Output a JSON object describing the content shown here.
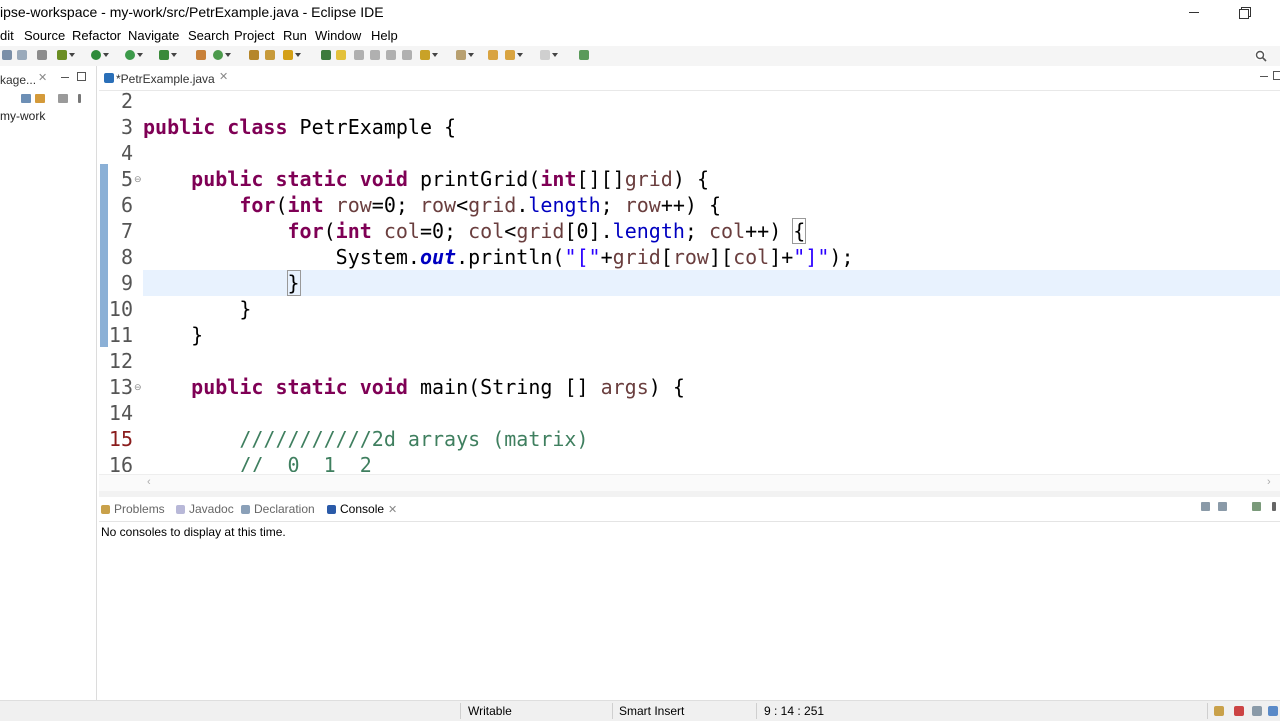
{
  "window": {
    "title": "ipse-workspace - my-work/src/PetrExample.java - Eclipse IDE"
  },
  "menu": [
    "dit",
    "Source",
    "Refactor",
    "Navigate",
    "Search",
    "Project",
    "Run",
    "Window",
    "Help"
  ],
  "package_explorer": {
    "tab_label": "kage...",
    "tree_item": "my-work"
  },
  "editor": {
    "tab_label": "*PetrExample.java",
    "current_line": 9,
    "code_lines": [
      {
        "n": "2",
        "text": ""
      },
      {
        "n": "3",
        "text": "public class PetrExample {"
      },
      {
        "n": "4",
        "text": ""
      },
      {
        "n": "5",
        "text": "    public static void printGrid(int[][]grid) {"
      },
      {
        "n": "6",
        "text": "        for(int row=0; row<grid.length; row++) {"
      },
      {
        "n": "7",
        "text": "            for(int col=0; col<grid[0].length; col++) {"
      },
      {
        "n": "8",
        "text": "                System.out.println(\"[\"+grid[row][col]+\"]\");"
      },
      {
        "n": "9",
        "text": "            }"
      },
      {
        "n": "10",
        "text": "        }"
      },
      {
        "n": "11",
        "text": "    }"
      },
      {
        "n": "12",
        "text": ""
      },
      {
        "n": "13",
        "text": "    public static void main(String [] args) {"
      },
      {
        "n": "14",
        "text": ""
      },
      {
        "n": "15",
        "text": "        ///////////2d arrays (matrix)"
      },
      {
        "n": "16",
        "text": "        //  0  1  2"
      }
    ]
  },
  "bottom_panel": {
    "tabs": [
      "Problems",
      "Javadoc",
      "Declaration",
      "Console"
    ],
    "active_tab": "Console",
    "message": "No consoles to display at this time."
  },
  "status_bar": {
    "mode": "Writable",
    "insert_mode": "Smart Insert",
    "position": "9 : 14 : 251"
  },
  "colors": {
    "keyword": "#7f0055",
    "string": "#2a00ff",
    "static_field": "#0000c0",
    "variable": "#6a3e3e",
    "comment": "#3f7f5f",
    "current_line": "#e8f2fe"
  }
}
